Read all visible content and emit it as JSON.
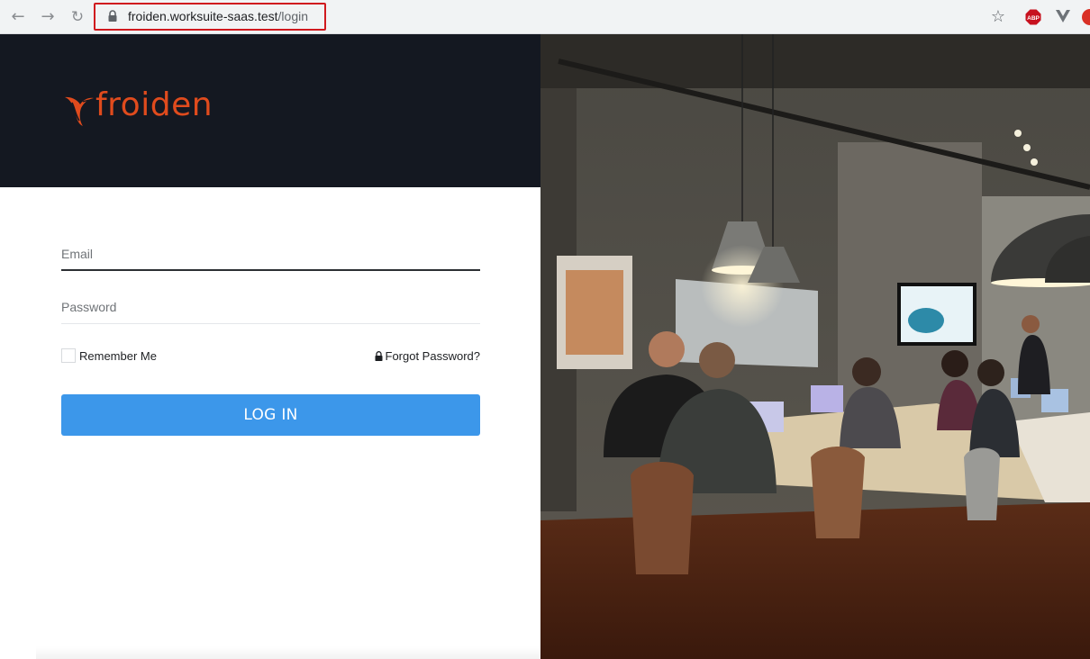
{
  "browser": {
    "url_host": "froiden.worksuite-saas.test",
    "url_path": "/login",
    "abp_badge": "ABP"
  },
  "brand": {
    "name": "froiden",
    "color": "#e04b1d",
    "bar_color": "#141821"
  },
  "login_form": {
    "email_placeholder": "Email",
    "password_placeholder": "Password",
    "remember_label": "Remember Me",
    "forgot_label": "Forgot Password?",
    "submit_label": "LOG IN",
    "submit_color": "#3c97ea"
  },
  "icons": {
    "back": "arrow-left-icon",
    "forward": "arrow-right-icon",
    "reload": "reload-icon",
    "lock": "lock-icon",
    "bookmark": "star-icon",
    "forgot": "padlock-icon"
  }
}
